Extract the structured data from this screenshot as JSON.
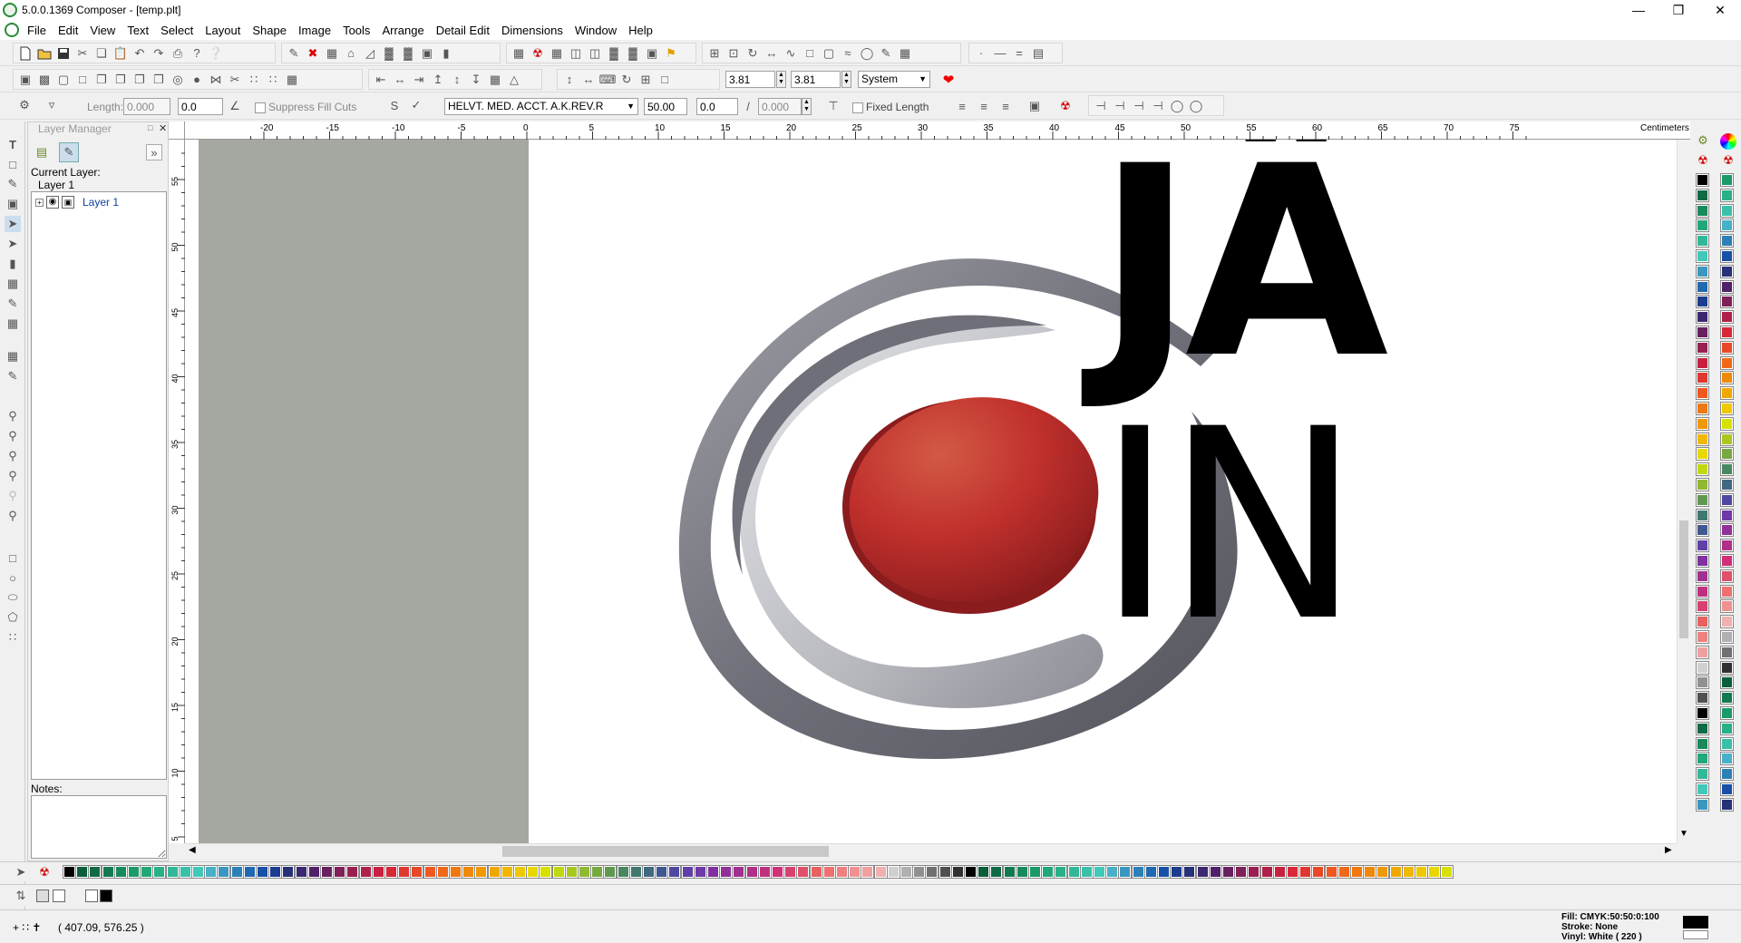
{
  "titlebar": {
    "title": "5.0.0.1369 Composer - [temp.plt]"
  },
  "menu": [
    "File",
    "Edit",
    "View",
    "Text",
    "Select",
    "Layout",
    "Shape",
    "Image",
    "Tools",
    "Arrange",
    "Detail Edit",
    "Dimensions",
    "Window",
    "Help"
  ],
  "toolbar2": {
    "width_value": "3.81",
    "height_value": "3.81",
    "units_select": "System"
  },
  "toolbar3": {
    "length_label": "Length:",
    "length_value": "0.000",
    "angle_value": "0.0",
    "suppress_label": "Suppress Fill Cuts",
    "font_value": "HELVT. MED. ACCT. A.K.REV.R",
    "size_value": "50.00",
    "spacing_value": "0.0",
    "slant_value": "0.000",
    "fixed_length_label": "Fixed Length"
  },
  "layer_manager": {
    "title": "Layer Manager",
    "current_layer_label": "Current Layer:",
    "current_layer_value": "Layer 1",
    "layers": [
      {
        "name": "Layer 1"
      }
    ],
    "notes_label": "Notes:"
  },
  "ruler": {
    "units": "Centimeters",
    "top_ticks": [
      "-20",
      "-15",
      "-10",
      "-5",
      "0",
      "5",
      "10",
      "15",
      "20",
      "25",
      "30",
      "35",
      "40",
      "45",
      "50",
      "55",
      "60",
      "65",
      "70",
      "75"
    ],
    "left_ticks": [
      "55",
      "50",
      "45",
      "40",
      "35",
      "30",
      "25",
      "20",
      "15",
      "10",
      "5"
    ]
  },
  "canvas": {
    "text_line1": "JÄ",
    "text_line2": "IN",
    "logo_red": "#c0302c",
    "logo_gray": "#6e6f78",
    "offpage_color": "#a5a8a0"
  },
  "status": {
    "coords": "( 407.09, 576.25 )",
    "fill": "Fill: CMYK:50:50:0:100",
    "stroke": "Stroke: None",
    "vinyl": "Vinyl: White ( 220 )"
  },
  "palette_colors": [
    "#000000",
    "#0b5e3a",
    "#0f6b45",
    "#137a50",
    "#178a5c",
    "#1a9a68",
    "#20a878",
    "#28b088",
    "#30b898",
    "#38c0a8",
    "#40c8b8",
    "#48b0c8",
    "#3a98c0",
    "#2c80b8",
    "#2068b0",
    "#1850a8",
    "#1c3c90",
    "#283078",
    "#3c2870",
    "#502068",
    "#682060",
    "#802058",
    "#982050",
    "#b02048",
    "#c82040",
    "#d82838",
    "#e03830",
    "#e84828",
    "#f05820",
    "#f06818",
    "#f07810",
    "#f08808",
    "#f09800",
    "#f0a800",
    "#f0b800",
    "#f0c800",
    "#e8d800",
    "#d8e000",
    "#c0d810",
    "#a8c820",
    "#90b830",
    "#78a840",
    "#609850",
    "#488860",
    "#407870",
    "#406880",
    "#405890",
    "#5048a0",
    "#6040a8",
    "#7038a8",
    "#8030a0",
    "#903098",
    "#a03090",
    "#b03088",
    "#c03080",
    "#d03078",
    "#d84070",
    "#e05068",
    "#e86060",
    "#f07070",
    "#f08080",
    "#f09090",
    "#f0a0a0",
    "#f0b0b0",
    "#d0d0d0",
    "#b0b0b0",
    "#909090",
    "#707070",
    "#505050",
    "#303030"
  ]
}
